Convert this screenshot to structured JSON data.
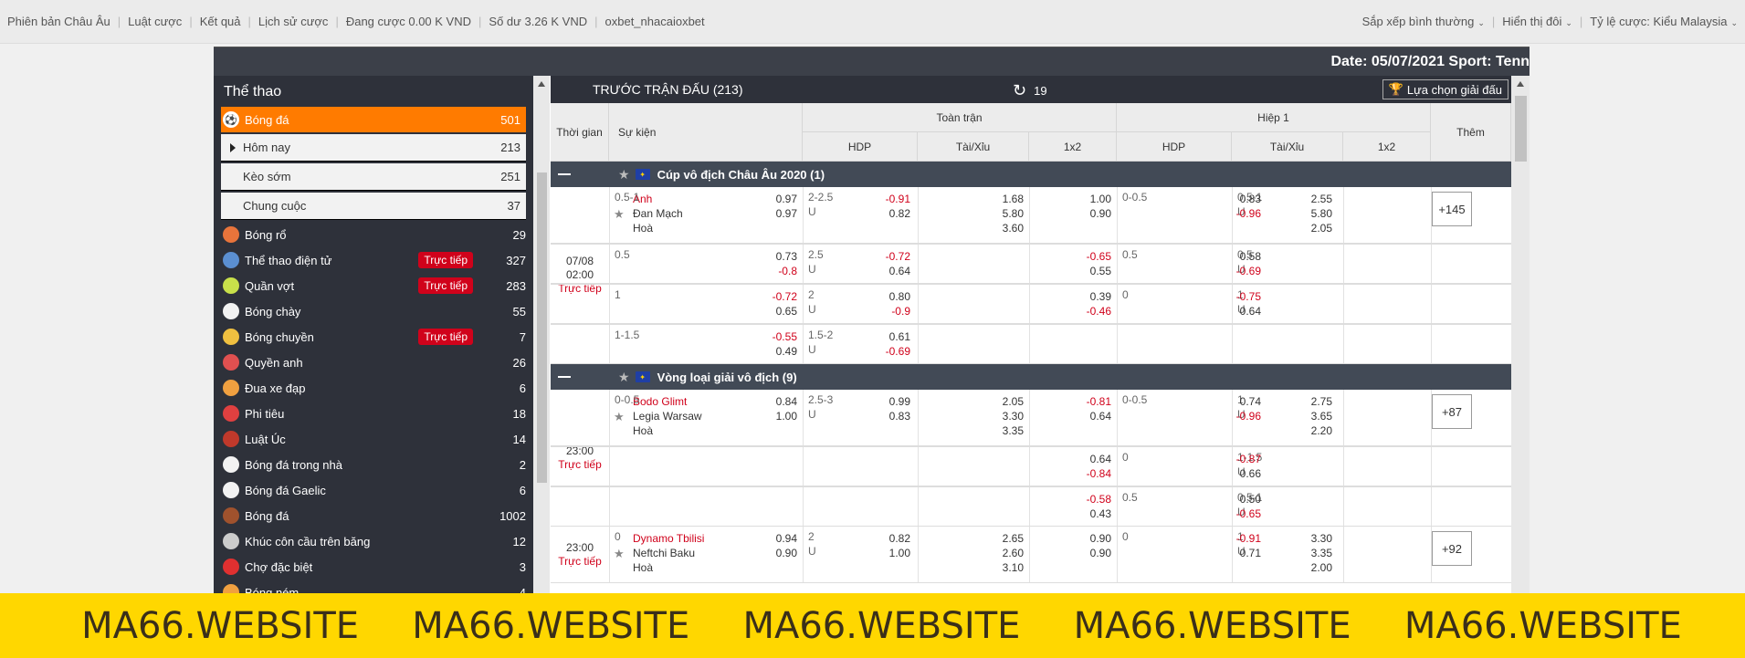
{
  "topbar": {
    "left": [
      "Phiên bản Châu Âu",
      "Luật cược",
      "Kết quả",
      "Lịch sử cược",
      "Đang cược 0.00 K VND",
      "Số dư 3.26 K VND",
      "oxbet_nhacaioxbet"
    ],
    "right": [
      "Sắp xếp bình thường",
      "Hiển thị đôi",
      "Tỷ lệ cược: Kiểu Malaysia"
    ]
  },
  "header": {
    "date_sport": "Date: 05/07/2021 Sport: Tenn"
  },
  "sidebar": {
    "title": "Thể thao",
    "active": {
      "label": "Bóng đá",
      "count": "501"
    },
    "sub": [
      {
        "label": "Hôm nay",
        "count": "213"
      },
      {
        "label": "Kèo sớm",
        "count": "251"
      },
      {
        "label": "Chung cuộc",
        "count": "37"
      }
    ],
    "sports": [
      {
        "label": "Bóng rổ",
        "count": "29",
        "live": "",
        "icon": "basketball-icon",
        "color": "#e8743b"
      },
      {
        "label": "Thể thao điện tử",
        "count": "327",
        "live": "Trực tiếp",
        "icon": "esports-icon",
        "color": "#5b8fd1"
      },
      {
        "label": "Quần vợt",
        "count": "283",
        "live": "Trực tiếp",
        "icon": "tennis-icon",
        "color": "#c8e04a"
      },
      {
        "label": "Bóng chày",
        "count": "55",
        "live": "",
        "icon": "baseball-icon",
        "color": "#f2f2f2"
      },
      {
        "label": "Bóng chuyền",
        "count": "7",
        "live": "Trực tiếp",
        "icon": "volleyball-icon",
        "color": "#f0c040"
      },
      {
        "label": "Quyền anh",
        "count": "26",
        "live": "",
        "icon": "boxing-icon",
        "color": "#e05050"
      },
      {
        "label": "Đua xe đạp",
        "count": "6",
        "live": "",
        "icon": "cycling-icon",
        "color": "#f0a040"
      },
      {
        "label": "Phi tiêu",
        "count": "18",
        "live": "",
        "icon": "darts-icon",
        "color": "#e04040"
      },
      {
        "label": "Luật Úc",
        "count": "14",
        "live": "",
        "icon": "aussie-rules-icon",
        "color": "#c0392b"
      },
      {
        "label": "Bóng đá trong nhà",
        "count": "2",
        "live": "",
        "icon": "futsal-icon",
        "color": "#f2f2f2"
      },
      {
        "label": "Bóng đá Gaelic",
        "count": "6",
        "live": "",
        "icon": "gaelic-football-icon",
        "color": "#f2f2f2"
      },
      {
        "label": "Bóng đá",
        "count": "1002",
        "live": "",
        "icon": "american-football-icon",
        "color": "#a0522d"
      },
      {
        "label": "Khúc côn cầu trên băng",
        "count": "12",
        "live": "",
        "icon": "ice-hockey-icon",
        "color": "#cccccc"
      },
      {
        "label": "Chợ đặc biệt",
        "count": "3",
        "live": "",
        "icon": "special-market-icon",
        "color": "#e03030"
      },
      {
        "label": "Bóng ném",
        "count": "4",
        "live": "",
        "icon": "handball-icon",
        "color": "#f0a040"
      }
    ]
  },
  "main": {
    "title": "TRƯỚC TRẬN ĐẤU (213)",
    "refresh_count": "19",
    "select_league": "Lựa chọn giải đấu",
    "cols": {
      "time": "Thời gian",
      "event": "Sự kiện",
      "full": "Toàn trận",
      "half": "Hiệp 1",
      "hdp": "HDP",
      "ou": "Tài/Xỉu",
      "x12": "1x2",
      "more": "Thêm"
    },
    "leagues": [
      {
        "name": "Cúp vô địch Châu Âu 2020 (1)"
      },
      {
        "name": "Vòng loại giải vô địch (9)"
      }
    ],
    "matches": [
      {
        "date": "07/08",
        "time": "02:00",
        "live": "Trực tiếp",
        "home": "Anh",
        "away": "Đan Mạch",
        "draw": "Hoà",
        "more": "+145",
        "rows": [
          {
            "hdp_line": "0.5-1",
            "hdp1": "0.97",
            "hdp2": "0.97",
            "ou_line": "2-2.5",
            "ou_u": "U",
            "ou1": "-0.91",
            "ou2": "0.82",
            "x1": "1.68",
            "x2": "5.80",
            "x3": "3.60",
            "h_hdp_line": "0-0.5",
            "h_hdp1": "1.00",
            "h_hdp2": "0.90",
            "h_ou_line": "0.5-1",
            "h_ou_u": "U",
            "h_ou1": "0.83",
            "h_ou2": "-0.96",
            "hx1": "2.55",
            "hx2": "5.80",
            "hx3": "2.05"
          },
          {
            "hdp_line": "0.5",
            "hdp1": "0.73",
            "hdp2": "-0.8",
            "ou_line": "2.5",
            "ou_u": "U",
            "ou1": "-0.72",
            "ou2": "0.64",
            "h_hdp_line": "0.5",
            "h_hdp1": "-0.65",
            "h_hdp2": "0.55",
            "h_ou_line": "0.5",
            "h_ou_u": "U",
            "h_ou1": "0.58",
            "h_ou2": "-0.69"
          },
          {
            "hdp_line": "1",
            "hdp1": "-0.72",
            "hdp2": "0.65",
            "ou_line": "2",
            "ou_u": "U",
            "ou1": "0.80",
            "ou2": "-0.9",
            "h_hdp_line": "0",
            "h_hdp1": "0.39",
            "h_hdp2": "-0.46",
            "h_ou_line": "1",
            "h_ou_u": "U",
            "h_ou1": "-0.75",
            "h_ou2": "0.64"
          },
          {
            "hdp_line": "1-1.5",
            "hdp1": "-0.55",
            "hdp2": "0.49",
            "ou_line": "1.5-2",
            "ou_u": "U",
            "ou1": "0.61",
            "ou2": "-0.69"
          }
        ]
      },
      {
        "time": "23:00",
        "live": "Trực tiếp",
        "home": "Bodo Glimt",
        "away": "Legia Warsaw",
        "draw": "Hoà",
        "more": "+87",
        "rows": [
          {
            "hdp_line": "0-0.5",
            "hdp1": "0.84",
            "hdp2": "1.00",
            "ou_line": "2.5-3",
            "ou_u": "U",
            "ou1": "0.99",
            "ou2": "0.83",
            "x1": "2.05",
            "x2": "3.30",
            "x3": "3.35",
            "h_hdp_line": "0-0.5",
            "h_hdp1": "-0.81",
            "h_hdp2": "0.64",
            "h_ou_line": "1",
            "h_ou_u": "U",
            "h_ou1": "0.74",
            "h_ou2": "-0.96",
            "hx1": "2.75",
            "hx2": "3.65",
            "hx3": "2.20"
          },
          {
            "h_hdp_line": "0",
            "h_hdp1": "0.64",
            "h_hdp2": "-0.84",
            "h_ou_line": "1-1.5",
            "h_ou_u": "U",
            "h_ou1": "-0.87",
            "h_ou2": "0.66"
          },
          {
            "h_hdp_line": "0.5",
            "h_hdp1": "-0.58",
            "h_hdp2": "0.43",
            "h_ou_line": "0.5-1",
            "h_ou_u": "U",
            "h_ou1": "0.50",
            "h_ou2": "-0.65"
          }
        ]
      },
      {
        "time": "23:00",
        "live": "Trực tiếp",
        "home": "Dynamo Tbilisi",
        "away": "Neftchi Baku",
        "draw": "Hoà",
        "more": "+92",
        "rows": [
          {
            "hdp_line": "0",
            "hdp1": "0.94",
            "hdp2": "0.90",
            "ou_line": "2",
            "ou_u": "U",
            "ou1": "0.82",
            "ou2": "1.00",
            "x1": "2.65",
            "x2": "2.60",
            "x3": "3.10",
            "h_hdp_line": "0",
            "h_hdp1": "0.90",
            "h_hdp2": "0.90",
            "h_ou_line": "1",
            "h_ou_u": "U",
            "h_ou1": "-0.91",
            "h_ou2": "0.71",
            "hx1": "3.30",
            "hx2": "3.35",
            "hx3": "2.00"
          }
        ]
      }
    ]
  },
  "banner": [
    "MA66.WEBSITE",
    "MA66.WEBSITE",
    "MA66.WEBSITE",
    "MA66.WEBSITE",
    "MA66.WEBSITE"
  ]
}
